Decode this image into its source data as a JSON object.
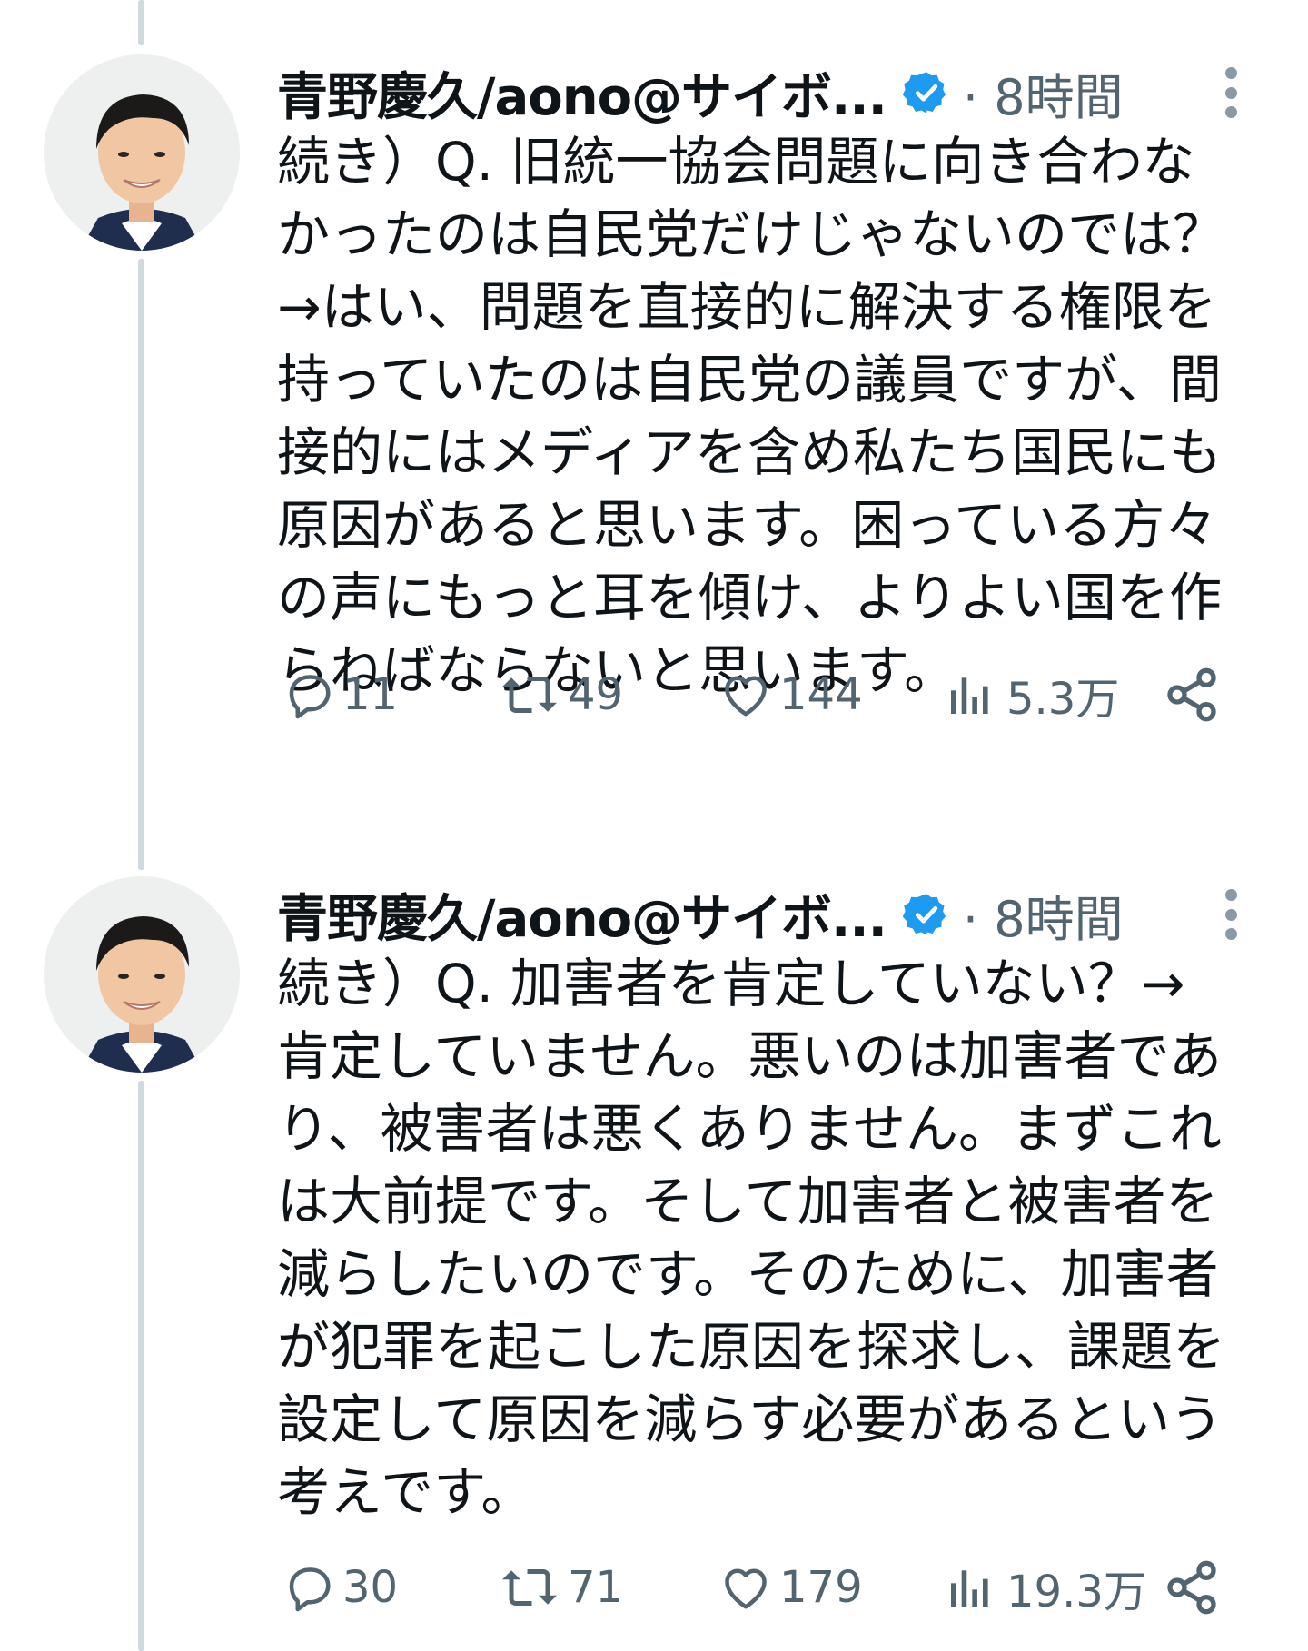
{
  "tweets": [
    {
      "author": "青野慶久/aono@サイボ...",
      "separator": "·",
      "time": "8時間",
      "text": "続き）Q. 旧統一協会問題に向き合わな\nかったのは自民党だけじゃないのでは？\n→はい、問題を直接的に解決する権限を\n持っていたのは自民党の議員ですが、間\n接的にはメディアを含め私たち国民にも\n原因があると思います。困っている方々\nの声にもっと耳を傾け、よりよい国を作\nらねばならないと思います。",
      "replies": "11",
      "retweets": "49",
      "likes": "144",
      "views": "5.3万"
    },
    {
      "author": "青野慶久/aono@サイボ...",
      "separator": "·",
      "time": "8時間",
      "text": "続き）Q. 加害者を肯定していない？→\n肯定していません。悪いのは加害者であ\nり、被害者は悪くありません。まずこれ\nは大前提です。そして加害者と被害者を\n減らしたいのです。そのために、加害者\nが犯罪を起こした原因を探求し、課題を\n設定して原因を減らす必要があるという\n考えです。",
      "replies": "30",
      "retweets": "71",
      "likes": "179",
      "views": "19.3万"
    }
  ],
  "icons": {
    "verified": "verified-badge-icon",
    "more": "more-vertical-icon",
    "reply": "reply-icon",
    "retweet": "retweet-icon",
    "like": "heart-icon",
    "views": "views-chart-icon",
    "share": "share-icon"
  },
  "colors": {
    "verified": "#1d9bf0",
    "secondary_text": "#536471",
    "thread_line": "#cfd9de"
  }
}
